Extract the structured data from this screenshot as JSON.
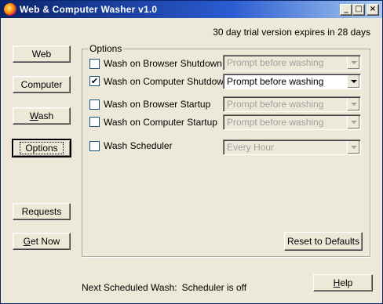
{
  "window": {
    "title": "Web & Computer Washer v1.0",
    "controls": {
      "minimize": "_",
      "maximize": "□",
      "close": "×"
    }
  },
  "trial_notice": "30 day trial version expires in 28 days",
  "sidebar": {
    "web": "Web",
    "computer": "Computer",
    "wash_pre": "",
    "wash_u": "W",
    "wash_post": "ash",
    "options": "Options",
    "requests": "Requests",
    "getnow_u": "G",
    "getnow_post": "et Now"
  },
  "options": {
    "group_title": "Options",
    "rows": [
      {
        "label": "Wash on Browser Shutdown",
        "checked": false,
        "combo": "Prompt before washing",
        "enabled": false
      },
      {
        "label": "Wash on Computer Shutdown",
        "checked": true,
        "combo": "Prompt before washing",
        "enabled": true
      },
      {
        "label": "Wash on Browser Startup",
        "checked": false,
        "combo": "Prompt before washing",
        "enabled": false
      },
      {
        "label": "Wash on Computer Startup",
        "checked": false,
        "combo": "Prompt before washing",
        "enabled": false
      },
      {
        "label": "Wash Scheduler",
        "checked": false,
        "combo": "Every Hour",
        "enabled": false
      }
    ],
    "reset_button": "Reset to Defaults"
  },
  "footer": {
    "next_label": "Next Scheduled Wash:",
    "next_value": "Scheduler is off",
    "help_u": "H",
    "help_post": "elp"
  },
  "checkmark": "✔"
}
